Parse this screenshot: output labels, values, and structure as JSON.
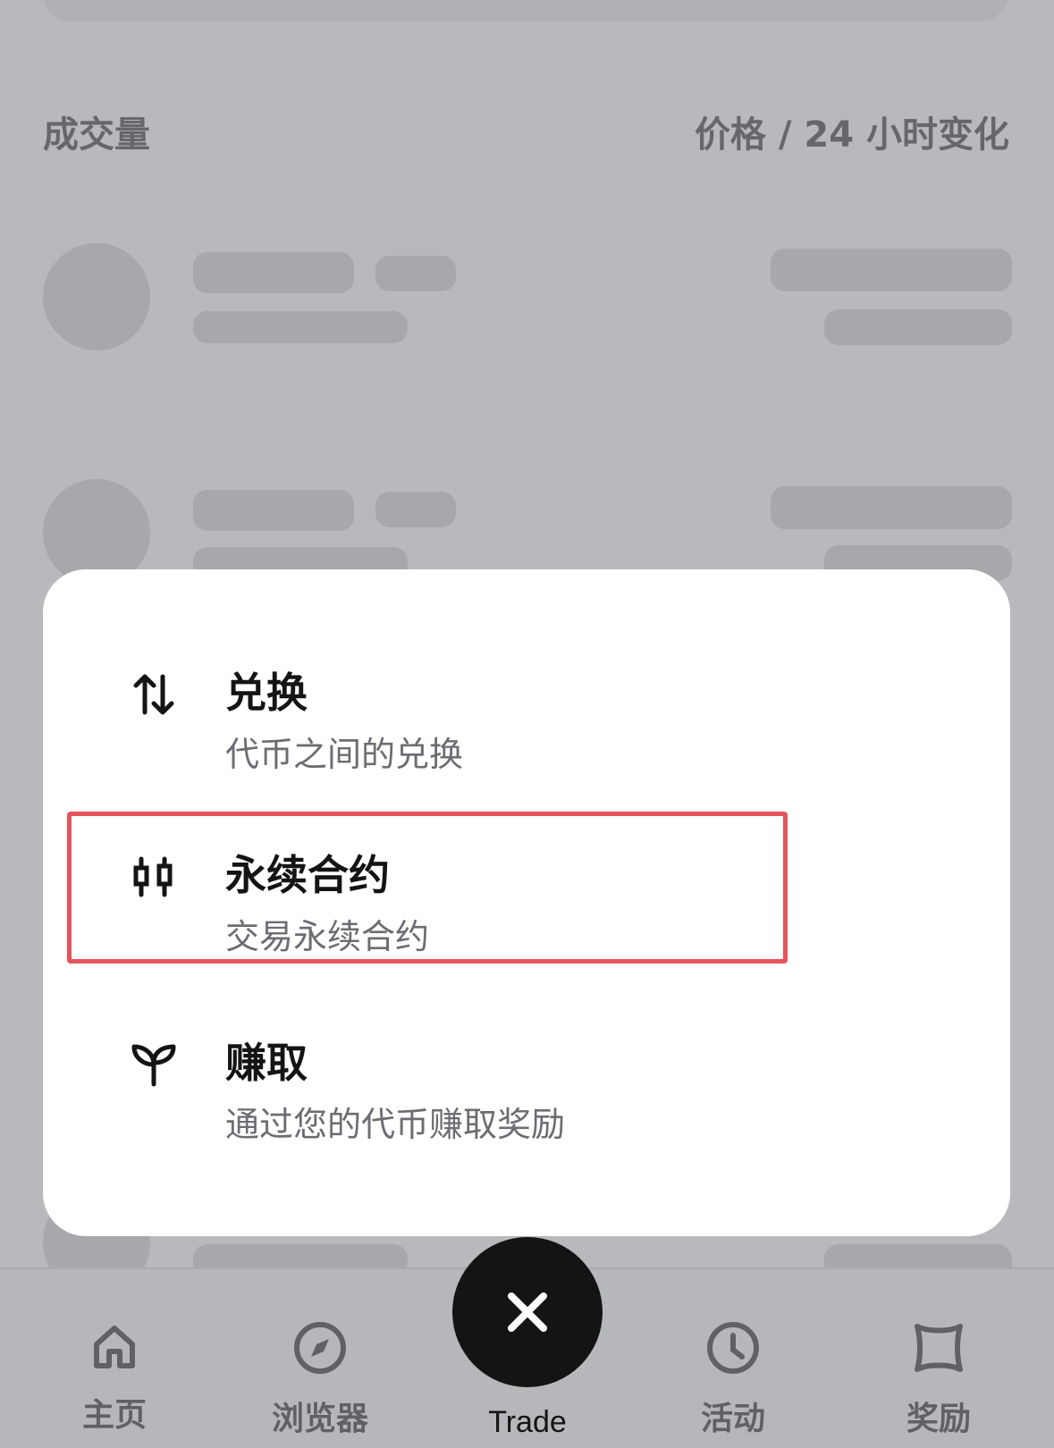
{
  "header": {
    "volume_label": "成交量",
    "price_label": "价格 / 24 小时变化"
  },
  "trade_menu": {
    "items": [
      {
        "icon": "swap-arrows-icon",
        "title": "兑换",
        "subtitle": "代币之间的兑换"
      },
      {
        "icon": "candlestick-icon",
        "title": "永续合约",
        "subtitle": "交易永续合约"
      },
      {
        "icon": "sprout-icon",
        "title": "赚取",
        "subtitle": "通过您的代币赚取奖励"
      }
    ],
    "highlighted_index": 1,
    "highlight_color": "#e5545a"
  },
  "bottom_nav": {
    "items": [
      {
        "icon": "home-icon",
        "label": "主页"
      },
      {
        "icon": "compass-icon",
        "label": "浏览器"
      },
      {
        "icon": "close-icon",
        "label": "Trade"
      },
      {
        "icon": "clock-icon",
        "label": "活动"
      },
      {
        "icon": "badge-icon",
        "label": "奖励"
      }
    ]
  }
}
